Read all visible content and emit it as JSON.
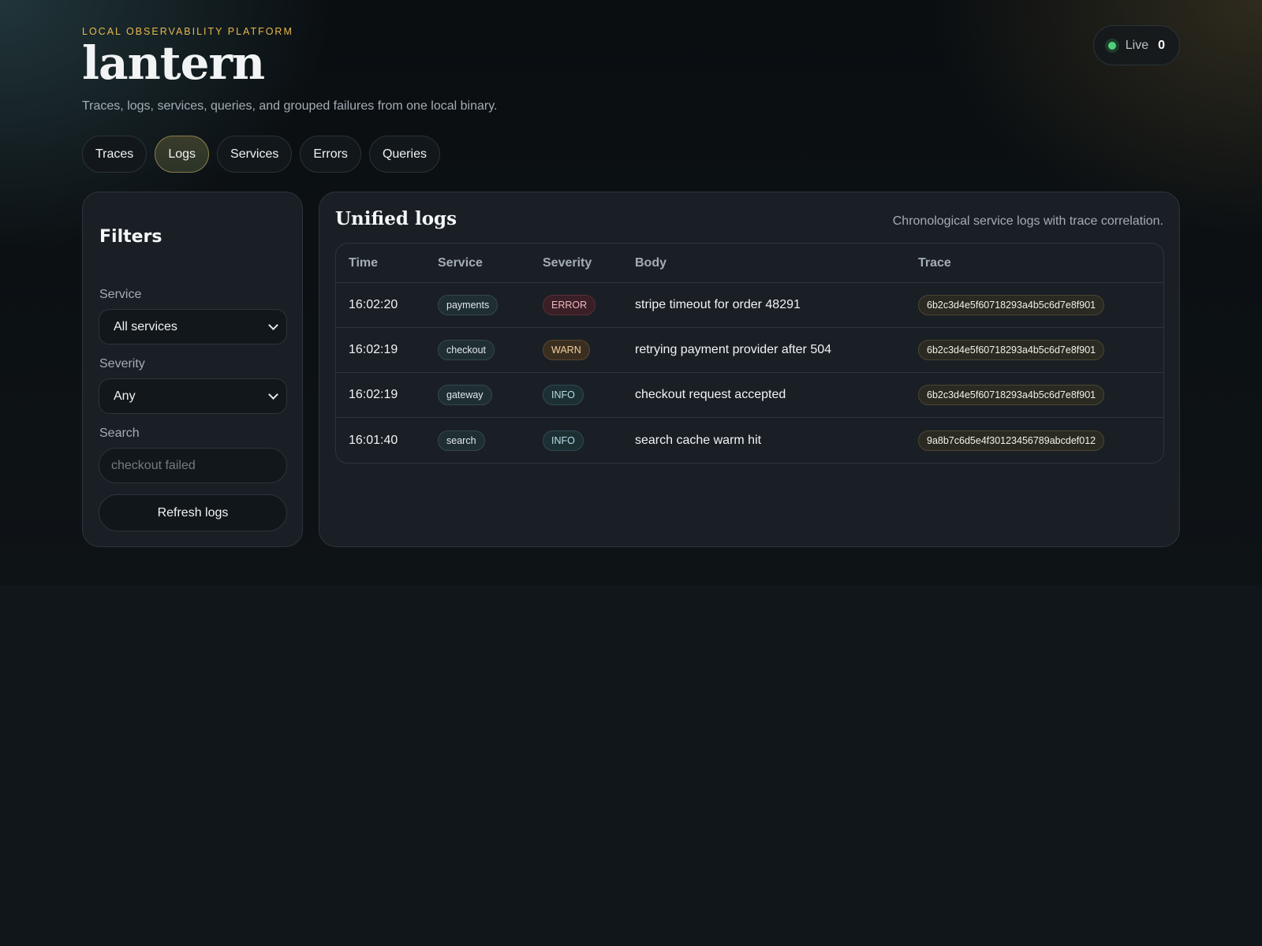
{
  "header": {
    "eyebrow": "LOCAL OBSERVABILITY PLATFORM",
    "brand": "lantern",
    "tagline": "Traces, logs, services, queries, and grouped failures from one local binary."
  },
  "live": {
    "label": "Live",
    "count": "0",
    "status_color": "#4ed17a"
  },
  "tabs": [
    {
      "label": "Traces",
      "active": false
    },
    {
      "label": "Logs",
      "active": true
    },
    {
      "label": "Services",
      "active": false
    },
    {
      "label": "Errors",
      "active": false
    },
    {
      "label": "Queries",
      "active": false
    }
  ],
  "filters": {
    "title": "Filters",
    "service_label": "Service",
    "service_value": "All services",
    "severity_label": "Severity",
    "severity_value": "Any",
    "search_label": "Search",
    "search_placeholder": "checkout failed",
    "refresh_label": "Refresh logs"
  },
  "logs": {
    "title": "Unified logs",
    "subtitle": "Chronological service logs with trace correlation.",
    "columns": [
      "Time",
      "Service",
      "Severity",
      "Body",
      "Trace"
    ],
    "rows": [
      {
        "time": "16:02:20",
        "service": "payments",
        "severity": "ERROR",
        "body": "stripe timeout for order 48291",
        "trace": "6b2c3d4e5f60718293a4b5c6d7e8f901"
      },
      {
        "time": "16:02:19",
        "service": "checkout",
        "severity": "WARN",
        "body": "retrying payment provider after 504",
        "trace": "6b2c3d4e5f60718293a4b5c6d7e8f901"
      },
      {
        "time": "16:02:19",
        "service": "gateway",
        "severity": "INFO",
        "body": "checkout request accepted",
        "trace": "6b2c3d4e5f60718293a4b5c6d7e8f901"
      },
      {
        "time": "16:01:40",
        "service": "search",
        "severity": "INFO",
        "body": "search cache warm hit",
        "trace": "9a8b7c6d5e4f30123456789abcdef012"
      }
    ]
  },
  "colors": {
    "accent": "#e9b84e",
    "error": "#f0b7bf",
    "warn": "#f3cf9c",
    "info": "#b7dde2"
  }
}
